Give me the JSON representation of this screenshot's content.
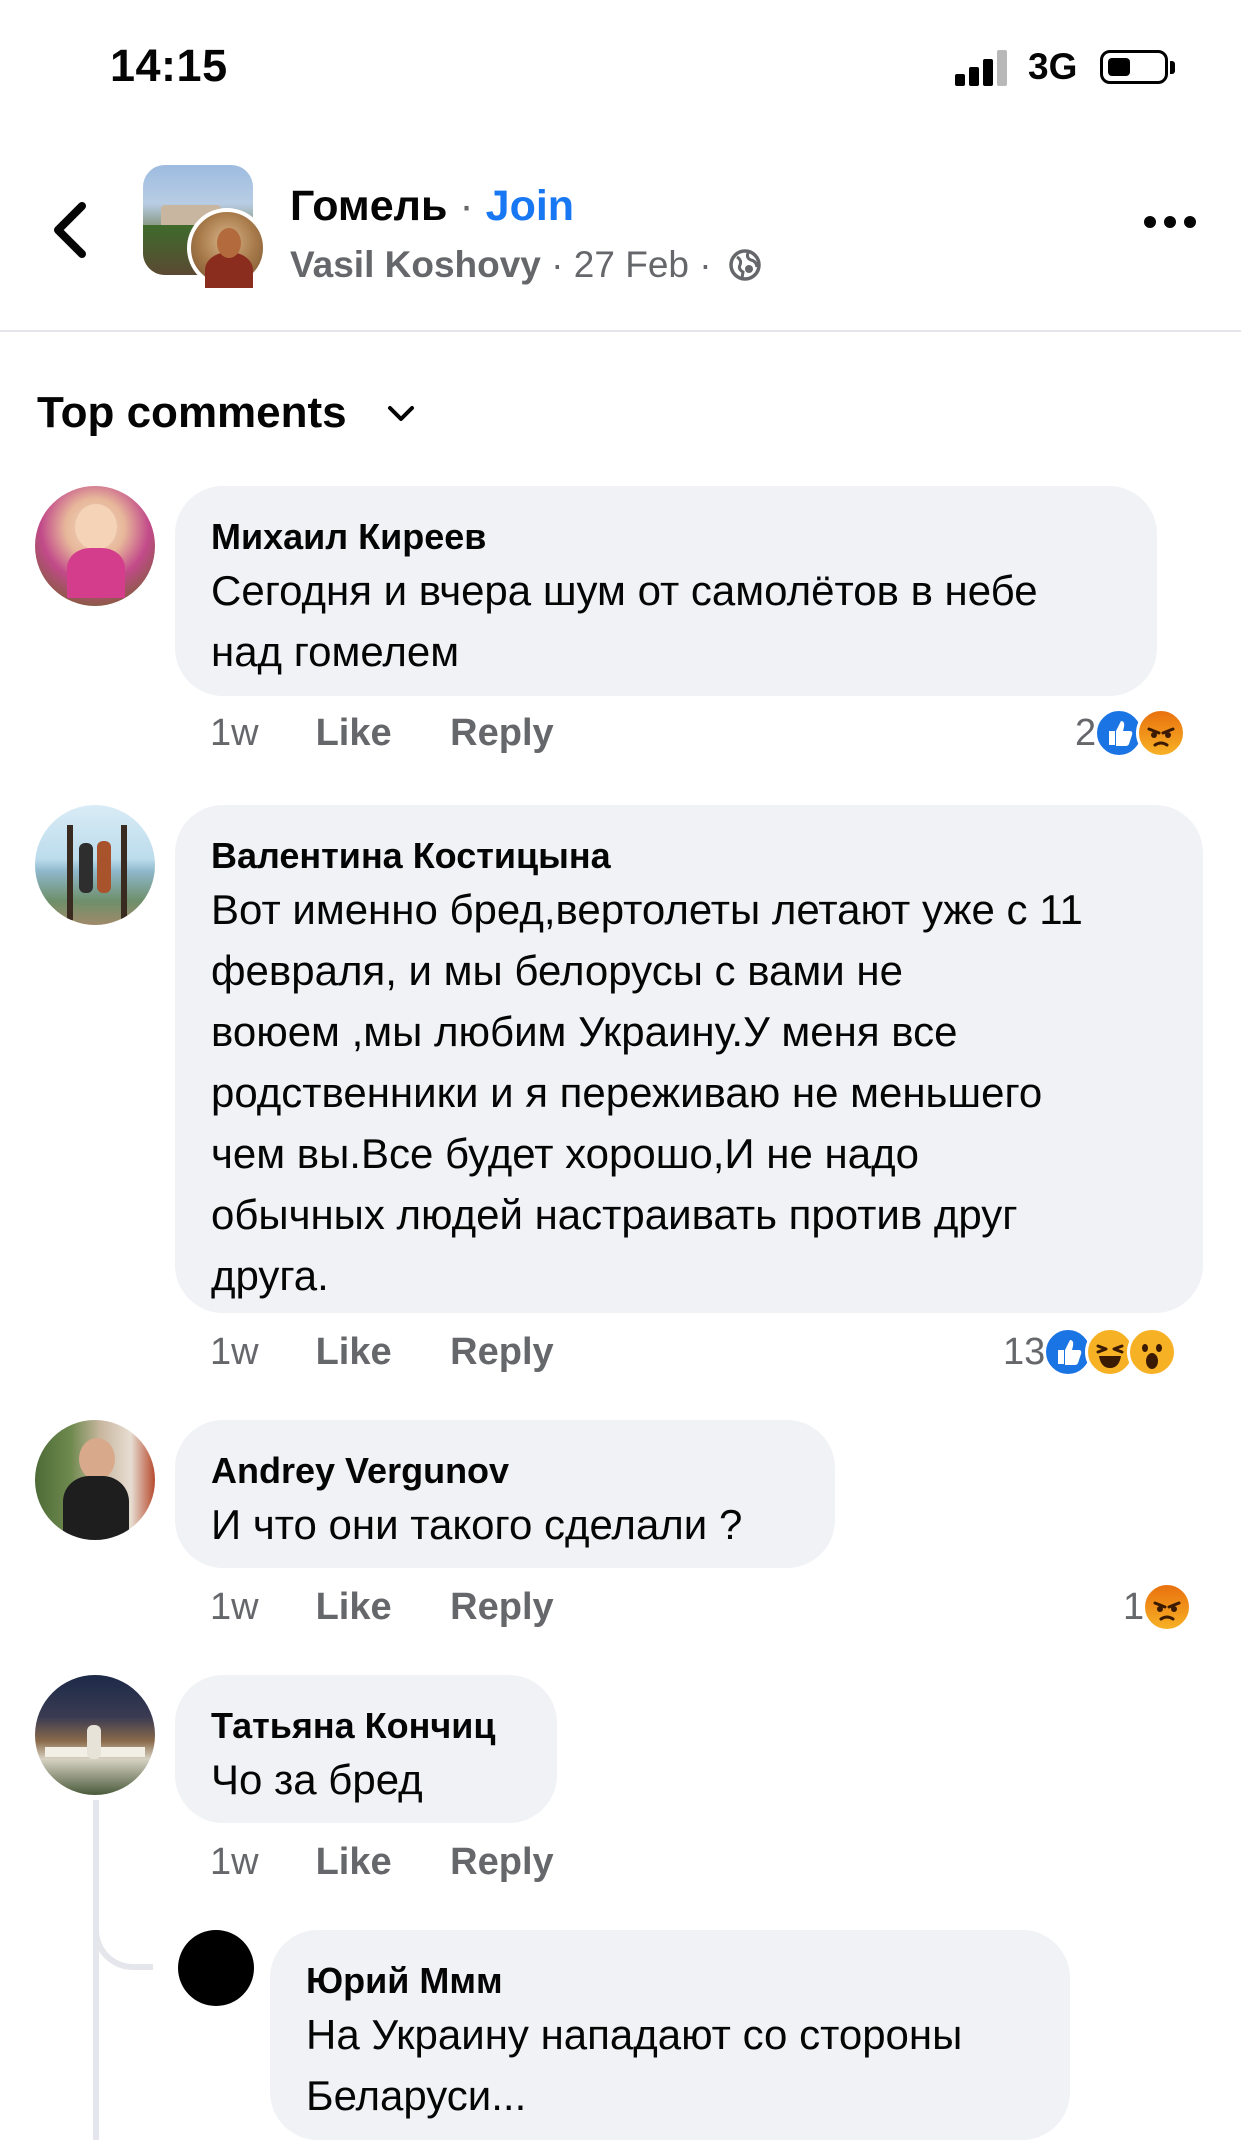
{
  "status_bar": {
    "time": "14:15",
    "network": "3G"
  },
  "header": {
    "group_name": "Гомель",
    "separator": "·",
    "join_label": "Join",
    "author": "Vasil Koshovy",
    "date": "27 Feb",
    "icons": [
      "back-chevron-icon",
      "globe-icon",
      "more-dots-icon"
    ]
  },
  "sort": {
    "label": "Top comments"
  },
  "comments": [
    {
      "name": "Михаил Киреев",
      "lines": [
        "Сегодня и вчера шум от самолётов в небе",
        "над гомелем"
      ],
      "time": "1w",
      "like": "Like",
      "reply": "Reply",
      "reaction_count": "2",
      "reactions": [
        "like",
        "angry"
      ]
    },
    {
      "name": "Валентина Костицына",
      "lines": [
        "Вот именно бред,вертолеты летают уже с 11",
        "февраля, и мы белорусы с вами не",
        "воюем ,мы любим Украину.У меня все",
        "родственники и я переживаю не меньшего",
        "чем вы.Все будет хорошо,И не надо",
        "обычных людей настраивать против друг",
        "друга."
      ],
      "time": "1w",
      "like": "Like",
      "reply": "Reply",
      "reaction_count": "13",
      "reactions": [
        "like",
        "haha",
        "wow"
      ]
    },
    {
      "name": "Andrey Vergunov",
      "lines": [
        "И что они такого сделали ?"
      ],
      "time": "1w",
      "like": "Like",
      "reply": "Reply",
      "reaction_count": "1",
      "reactions": [
        "angry"
      ]
    },
    {
      "name": "Татьяна Кончиц",
      "lines": [
        "Чо за бред"
      ],
      "time": "1w",
      "like": "Like",
      "reply": "Reply"
    }
  ],
  "reply": {
    "name": "Юрий Ммм",
    "lines": [
      "На Украину нападают со стороны",
      "Беларуси..."
    ]
  },
  "colors": {
    "link_blue": "#1877f2",
    "bubble_bg": "#f0f2f5",
    "secondary_text": "#65676b"
  }
}
